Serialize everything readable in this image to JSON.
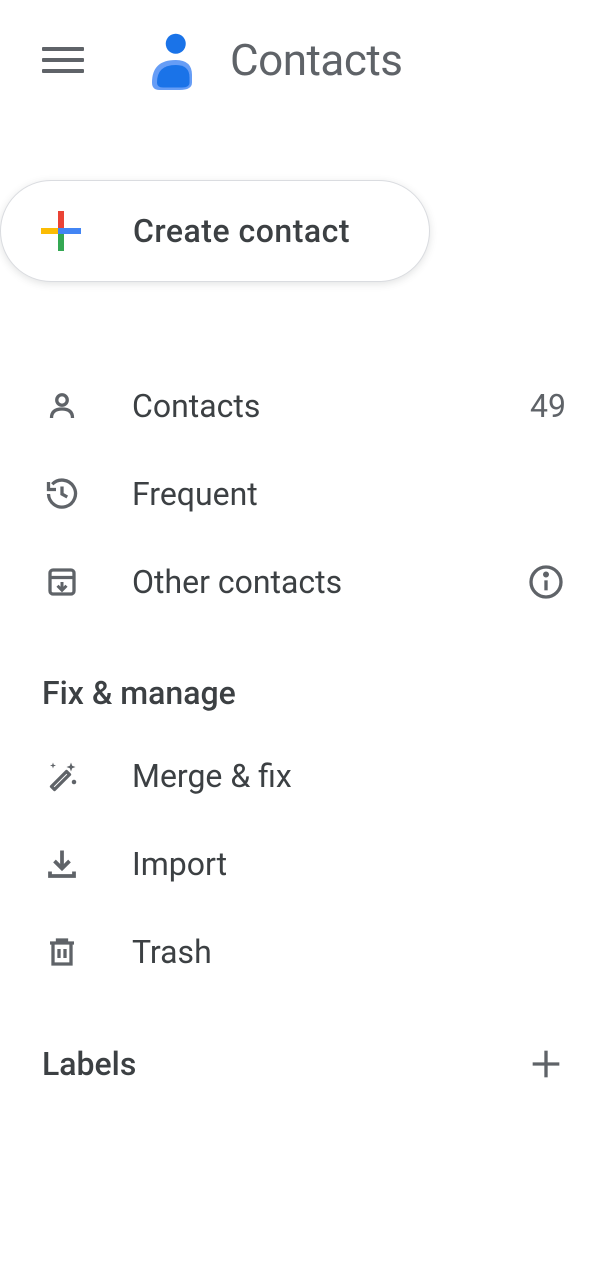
{
  "header": {
    "title": "Contacts"
  },
  "create": {
    "label": "Create contact"
  },
  "nav": {
    "items": [
      {
        "label": "Contacts",
        "count": "49"
      },
      {
        "label": "Frequent"
      },
      {
        "label": "Other contacts"
      }
    ]
  },
  "sections": {
    "fix_manage": {
      "title": "Fix & manage",
      "items": [
        {
          "label": "Merge & fix"
        },
        {
          "label": "Import"
        },
        {
          "label": "Trash"
        }
      ]
    },
    "labels": {
      "title": "Labels"
    }
  }
}
